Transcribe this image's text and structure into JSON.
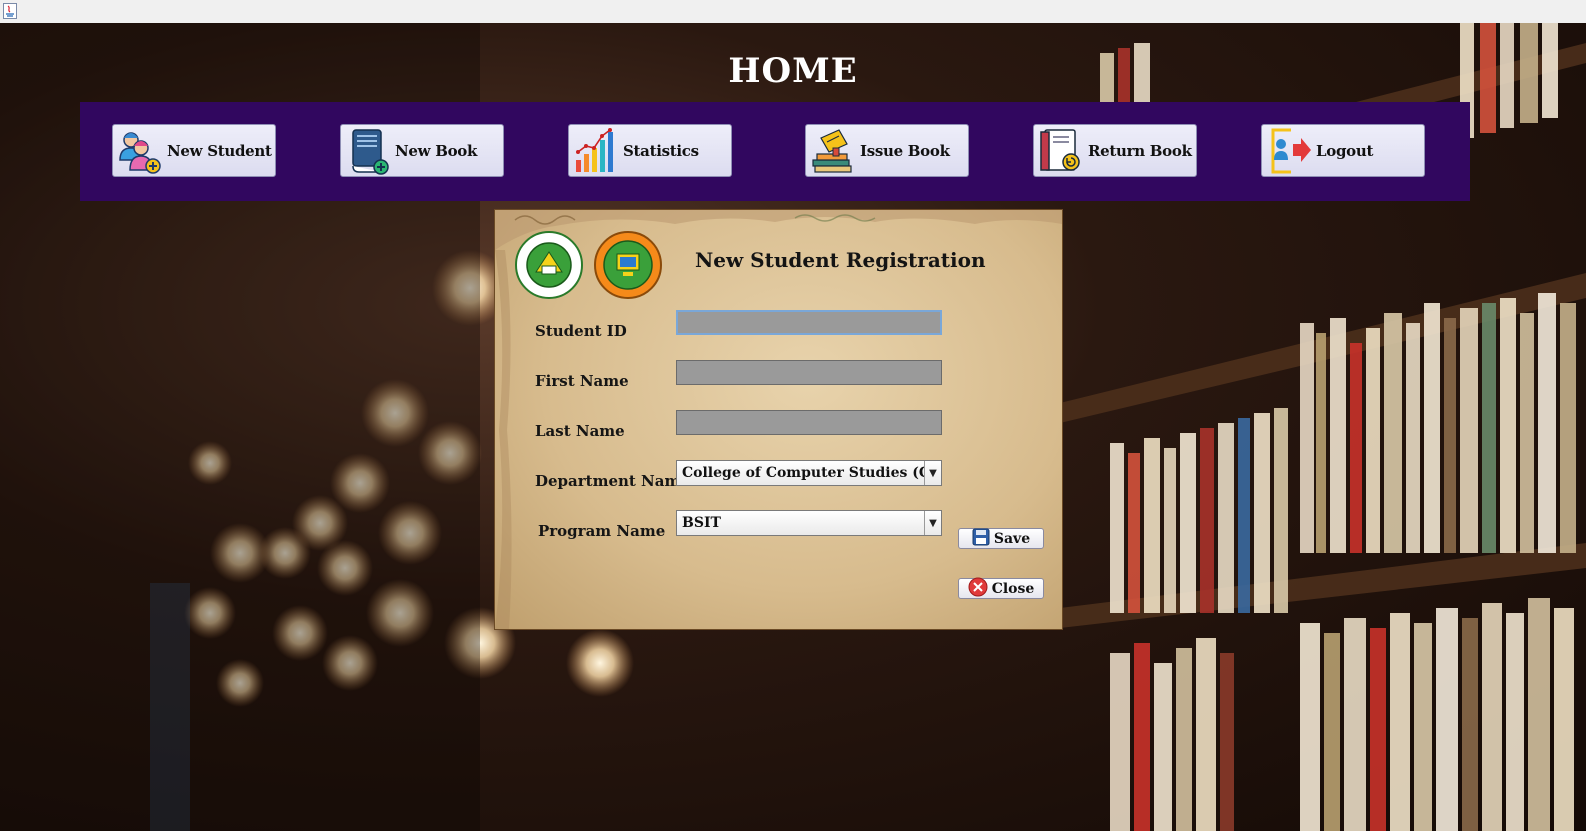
{
  "window": {
    "icon": "java-icon"
  },
  "header": {
    "title": "HOME"
  },
  "nav": {
    "items": [
      {
        "label": "New Student",
        "icon": "add-student-icon"
      },
      {
        "label": "New Book",
        "icon": "add-book-icon"
      },
      {
        "label": "Statistics",
        "icon": "bar-chart-icon"
      },
      {
        "label": "Issue Book",
        "icon": "issue-book-icon"
      },
      {
        "label": "Return Book",
        "icon": "return-book-icon"
      },
      {
        "label": "Logout",
        "icon": "logout-icon"
      }
    ]
  },
  "form": {
    "title": "New Student Registration",
    "fields": {
      "student_id": {
        "label": "Student ID",
        "value": ""
      },
      "first_name": {
        "label": "First Name",
        "value": ""
      },
      "last_name": {
        "label": "Last Name",
        "value": ""
      },
      "department": {
        "label": "Department Name",
        "value": "College of Computer Studies (CCS)"
      },
      "program": {
        "label": "Program Name",
        "value": "BSIT"
      }
    },
    "save_label": "Save",
    "close_label": "Close"
  },
  "colors": {
    "navbar": "#31075f",
    "panel": "#d9bf92",
    "field": "#9a9a9a"
  }
}
